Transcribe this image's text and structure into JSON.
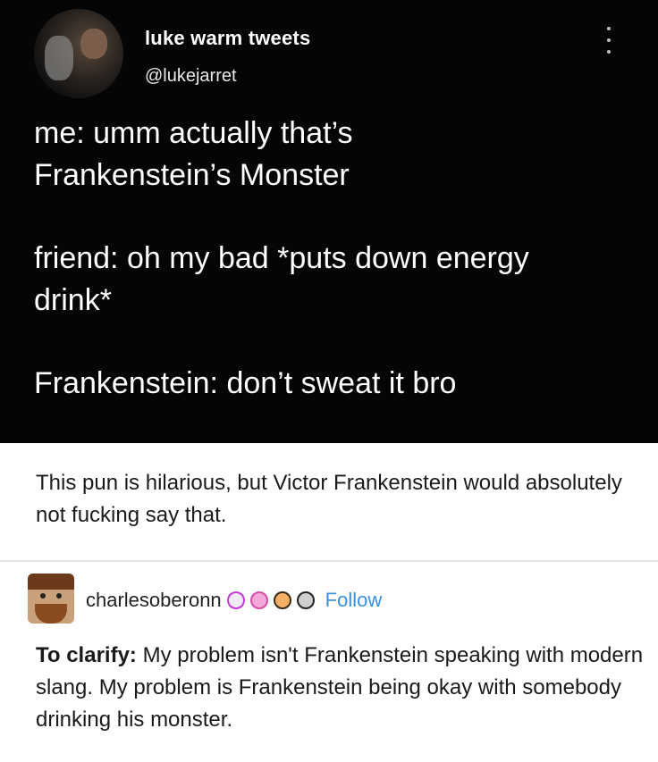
{
  "tweet": {
    "display_name": "luke warm tweets",
    "handle": "@lukejarret",
    "lines": [
      "me: umm actually that’s",
      "Frankenstein’s Monster",
      "friend: oh my bad *puts down energy",
      "drink*",
      "Frankenstein: don’t sweat it bro"
    ]
  },
  "comment1": {
    "text": "This pun is hilarious, but Victor Frankenstein would absolutely not fucking say that."
  },
  "reblog": {
    "username": "charlesoberonn",
    "follow_label": "Follow",
    "badges": [
      "crab-badge-icon",
      "pink-badge-icon",
      "paw-badge-icon",
      "dark-badge-icon"
    ],
    "bold_prefix": "To clarify:",
    "text": " My problem isn't Frankenstein speaking with modern slang. My problem is Frankenstein being okay with somebody drinking his monster."
  },
  "colors": {
    "tweet_background": "#050505",
    "follow_link": "#3c8fe0"
  }
}
